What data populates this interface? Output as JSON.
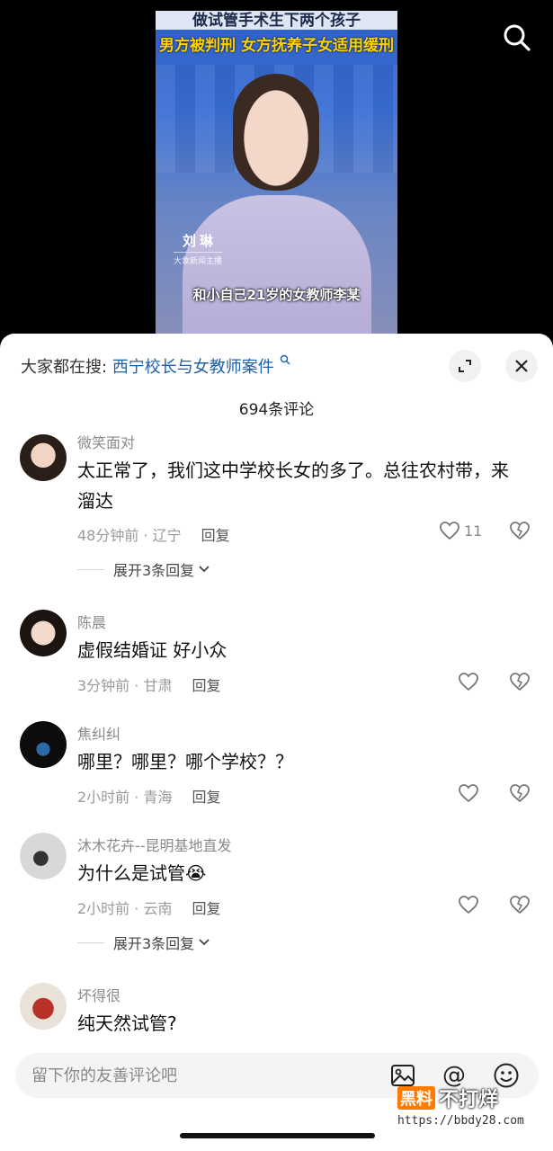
{
  "video": {
    "headline_top": "做试管手术生下两个孩子",
    "headline_main": "男方被判刑 女方抚养子女适用缓刑",
    "anchor_name": "刘琳",
    "anchor_title": "大象新闻主播",
    "subtitle": "和小自己21岁的女教师李某",
    "search_icon": "search-icon"
  },
  "sheet": {
    "hot_search_label": "大家都在搜:",
    "hot_search_query": "西宁校长与女教师案件",
    "comment_count": "694条评论"
  },
  "comments": [
    {
      "name": "微笑面对",
      "text": "太正常了，我们这中学校长女的多了。总往农村带，来溜达",
      "time_location": "48分钟前 · 辽宁",
      "reply_label": "回复",
      "likes": "11",
      "expand_label": "展开3条回复"
    },
    {
      "name": "陈晨",
      "text": "虚假结婚证 好小众",
      "time_location": "3分钟前 · 甘肃",
      "reply_label": "回复"
    },
    {
      "name": "焦纠纠",
      "text": "哪里？哪里？哪个学校？？",
      "time_location": "2小时前 · 青海",
      "reply_label": "回复"
    },
    {
      "name": "沐木花卉--昆明基地直发",
      "text": "为什么是试管",
      "emoji": "😭",
      "time_location": "2小时前 · 云南",
      "reply_label": "回复",
      "expand_label": "展开3条回复"
    },
    {
      "name": "坏得很",
      "text": "纯天然试管?"
    }
  ],
  "input": {
    "placeholder": "留下你的友善评论吧",
    "at_symbol": "@"
  },
  "watermark": {
    "box": "黑料",
    "text": "不打烊",
    "url": "https://bbdy28.com"
  },
  "colors": {
    "link": "#1f5fa8",
    "watermark_orange": "#ff7a00"
  }
}
